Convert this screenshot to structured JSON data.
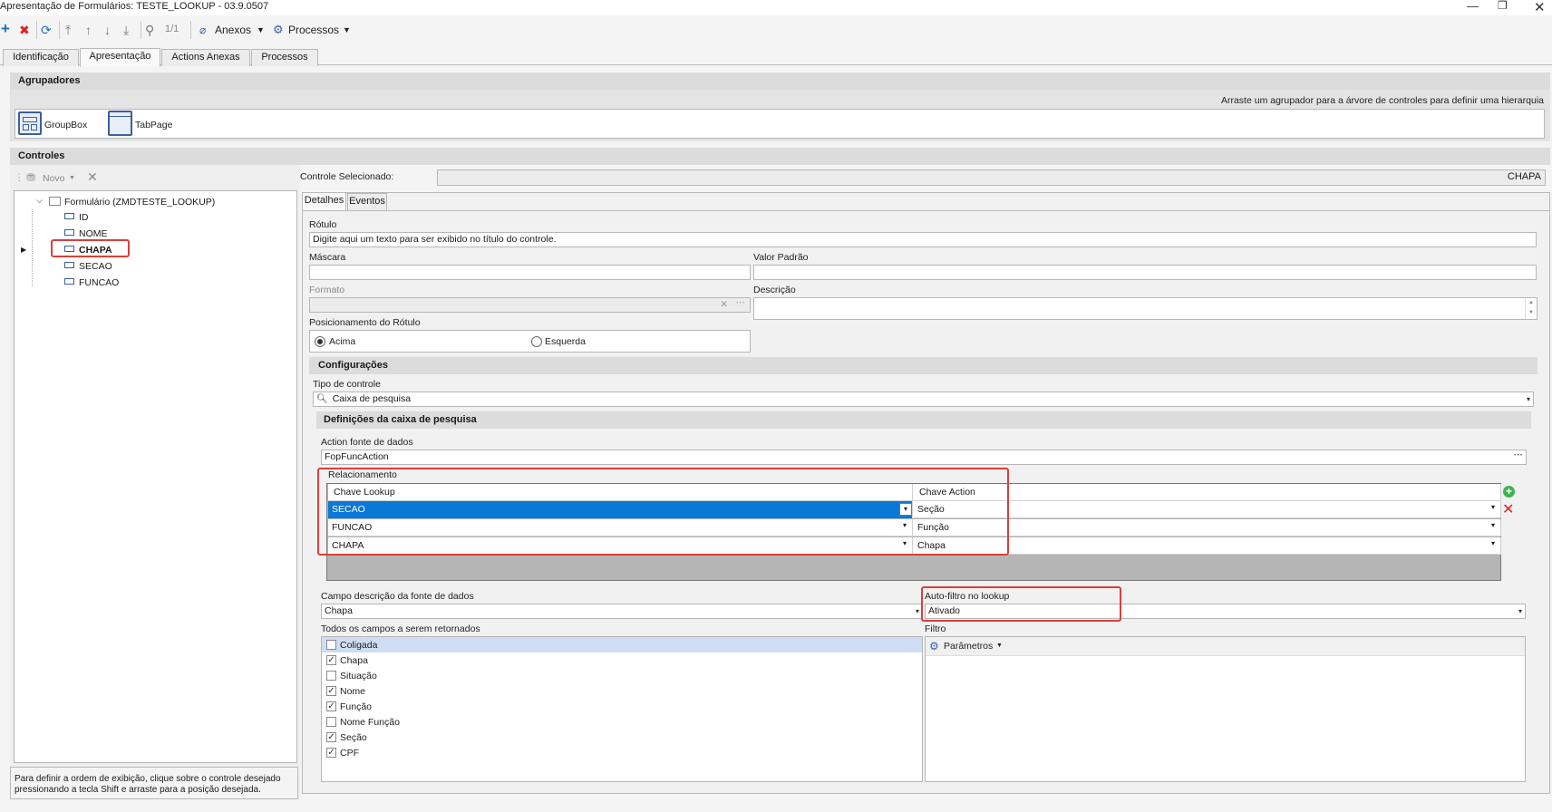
{
  "window": {
    "title": "Apresentação de Formulários: TESTE_LOOKUP - 03.9.0507"
  },
  "toolbar": {
    "paging": "1/1",
    "anexos_label": "Anexos",
    "processos_label": "Processos"
  },
  "tabs": [
    "Identificação",
    "Apresentação",
    "Actions Anexas",
    "Processos"
  ],
  "agrupadores": {
    "header": "Agrupadores",
    "hint": "Arraste um agrupador para a árvore de controles para definir uma hierarquia",
    "items": [
      "GroupBox",
      "TabPage"
    ]
  },
  "controles": {
    "header": "Controles",
    "novo_label": "Novo",
    "selected_label": "Controle Selecionado:",
    "selected_value": "CHAPA",
    "tree_root": "Formulário (ZMDTESTE_LOOKUP)",
    "tree_items": [
      "ID",
      "NOME",
      "CHAPA",
      "SECAO",
      "FUNCAO"
    ],
    "footer_hint": "Para definir a ordem de exibição, clique sobre o controle desejado pressionando a tecla Shift e arraste para a posição desejada."
  },
  "detail_tabs": [
    "Detalhes",
    "Eventos"
  ],
  "detalhes": {
    "rotulo_label": "Rótulo",
    "rotulo_value": "Digite aqui um texto para ser exibido no título do controle.",
    "mascara_label": "Máscara",
    "valor_padrao_label": "Valor Padrão",
    "formato_label": "Formato",
    "descricao_label": "Descrição",
    "posicionamento_label": "Posicionamento do Rótulo",
    "pos_options": [
      "Acima",
      "Esquerda"
    ],
    "pos_selected": "Acima"
  },
  "configuracoes": {
    "header": "Configurações",
    "tipo_label": "Tipo de controle",
    "tipo_value": "Caixa de pesquisa",
    "definicoes_header": "Definições da caixa de pesquisa",
    "action_label": "Action fonte de dados",
    "action_value": "FopFuncAction",
    "relacionamento_label": "Relacionamento",
    "grid_headers": [
      "Chave Lookup",
      "Chave Action"
    ],
    "grid_rows": [
      {
        "lookup": "SECAO",
        "action": "Seção",
        "selected": true
      },
      {
        "lookup": "FUNCAO",
        "action": "Função",
        "selected": false
      },
      {
        "lookup": "CHAPA",
        "action": "Chapa",
        "selected": false
      }
    ],
    "campo_desc_label": "Campo descrição da fonte de dados",
    "campo_desc_value": "Chapa",
    "autofiltro_label": "Auto-filtro no lookup",
    "autofiltro_value": "Ativado",
    "todos_campos_label": "Todos os campos a serem retornados",
    "campos": [
      {
        "name": "Coligada",
        "checked": false
      },
      {
        "name": "Chapa",
        "checked": true
      },
      {
        "name": "Situação",
        "checked": false
      },
      {
        "name": "Nome",
        "checked": true
      },
      {
        "name": "Função",
        "checked": true
      },
      {
        "name": "Nome Função",
        "checked": false
      },
      {
        "name": "Seção",
        "checked": true
      },
      {
        "name": "CPF",
        "checked": true
      }
    ],
    "filtro_label": "Filtro",
    "parametros_label": "Parâmetros"
  },
  "colors": {
    "selection_blue": "#0a78d7",
    "highlight_red": "#d9403a",
    "header_gray": "#dcdcdc"
  }
}
